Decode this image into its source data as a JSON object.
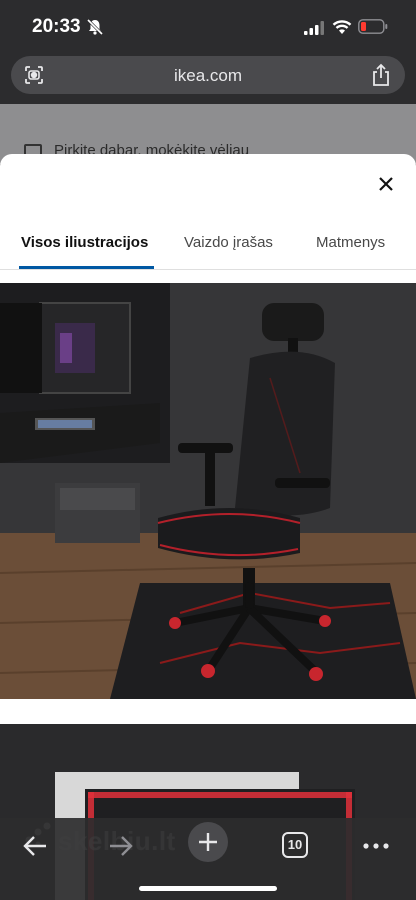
{
  "status_bar": {
    "time": "20:33"
  },
  "browser": {
    "url": "ikea.com",
    "tab_count": "10"
  },
  "background_page": {
    "promo_text": "Pirkite dabar, mokėkite vėliau"
  },
  "modal": {
    "tabs": [
      {
        "label": "Visos iliustracijos",
        "active": true
      },
      {
        "label": "Vaizdo įrašas",
        "active": false
      },
      {
        "label": "Matmenys",
        "active": false
      }
    ]
  },
  "watermark": {
    "text": "skelbiu.lt"
  },
  "colors": {
    "accent": "#0058a3",
    "toolbar": "#2c2c2e"
  },
  "icons": [
    "bell-slash-icon",
    "signal-icon",
    "wifi-icon",
    "battery-low-icon",
    "site-settings-icon",
    "share-icon",
    "close-icon",
    "back-icon",
    "forward-icon",
    "plus-icon",
    "tabs-icon",
    "more-icon"
  ]
}
